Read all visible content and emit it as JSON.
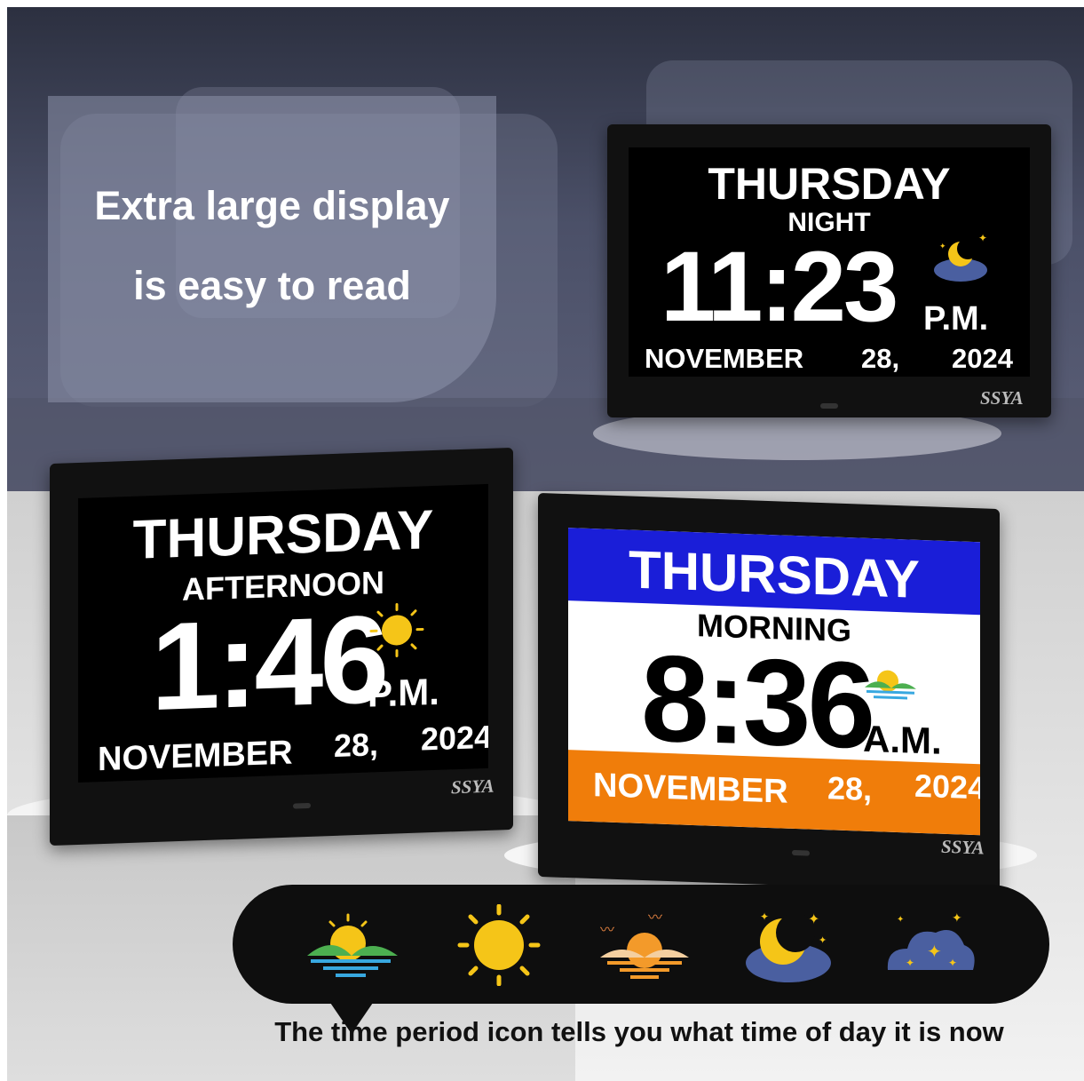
{
  "headline": {
    "line1": "Extra large display",
    "line2": "is easy to read"
  },
  "clocks": [
    {
      "id": "night",
      "day": "THURSDAY",
      "period": "NIGHT",
      "time": "11:23",
      "ampm": "P.M.",
      "month": "NOVEMBER",
      "date": "28,",
      "year": "2024",
      "brand": "SSYA",
      "icon": "moon-cloud-icon"
    },
    {
      "id": "afternoon",
      "day": "THURSDAY",
      "period": "AFTERNOON",
      "time": "1:46",
      "ampm": "P.M.",
      "month": "NOVEMBER",
      "date": "28,",
      "year": "2024",
      "brand": "SSYA",
      "icon": "sun-icon"
    },
    {
      "id": "morning",
      "day": "THURSDAY",
      "period": "MORNING",
      "time": "8:36",
      "ampm": "A.M.",
      "month": "NOVEMBER",
      "date": "28,",
      "year": "2024",
      "brand": "SSYA",
      "icon": "sunrise-icon",
      "colors": {
        "top": "#1a1ed8",
        "middle": "#ffffff",
        "bottom": "#f07d0a"
      }
    }
  ],
  "period_icons": [
    "sunrise-icon",
    "sun-icon",
    "sunset-icon",
    "moon-cloud-icon",
    "starry-cloud-icon"
  ],
  "caption": "The time period icon tells you what time of day it is now"
}
